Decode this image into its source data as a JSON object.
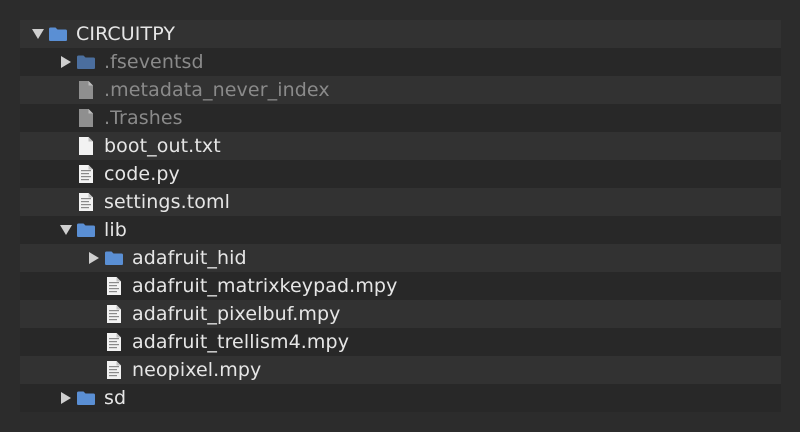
{
  "colors": {
    "panel_bg": "#282828",
    "row_alt_bg": "#323232",
    "folder_blue": "#5b8fd4",
    "hidden_text": "#8a8a8a",
    "normal_text": "#e6e6e6"
  },
  "tree": [
    {
      "label": "CIRCUITPY",
      "depth": 0,
      "kind": "folder",
      "expanded": true,
      "hidden": false,
      "icon": "folder-icon"
    },
    {
      "label": ".fseventsd",
      "depth": 1,
      "kind": "folder",
      "expanded": false,
      "hidden": true,
      "icon": "folder-icon"
    },
    {
      "label": ".metadata_never_index",
      "depth": 1,
      "kind": "file",
      "hidden": true,
      "icon": "file-icon"
    },
    {
      "label": ".Trashes",
      "depth": 1,
      "kind": "file",
      "hidden": true,
      "icon": "file-icon"
    },
    {
      "label": "boot_out.txt",
      "depth": 1,
      "kind": "file",
      "hidden": false,
      "icon": "text-file-icon"
    },
    {
      "label": "code.py",
      "depth": 1,
      "kind": "file",
      "hidden": false,
      "icon": "code-file-icon"
    },
    {
      "label": "settings.toml",
      "depth": 1,
      "kind": "file",
      "hidden": false,
      "icon": "code-file-icon"
    },
    {
      "label": "lib",
      "depth": 1,
      "kind": "folder",
      "expanded": true,
      "hidden": false,
      "icon": "folder-icon"
    },
    {
      "label": "adafruit_hid",
      "depth": 2,
      "kind": "folder",
      "expanded": false,
      "hidden": false,
      "icon": "folder-icon"
    },
    {
      "label": "adafruit_matrixkeypad.mpy",
      "depth": 2,
      "kind": "file",
      "hidden": false,
      "icon": "code-file-icon"
    },
    {
      "label": "adafruit_pixelbuf.mpy",
      "depth": 2,
      "kind": "file",
      "hidden": false,
      "icon": "code-file-icon"
    },
    {
      "label": "adafruit_trellism4.mpy",
      "depth": 2,
      "kind": "file",
      "hidden": false,
      "icon": "code-file-icon"
    },
    {
      "label": "neopixel.mpy",
      "depth": 2,
      "kind": "file",
      "hidden": false,
      "icon": "code-file-icon"
    },
    {
      "label": "sd",
      "depth": 1,
      "kind": "folder",
      "expanded": false,
      "hidden": false,
      "icon": "folder-icon"
    }
  ]
}
